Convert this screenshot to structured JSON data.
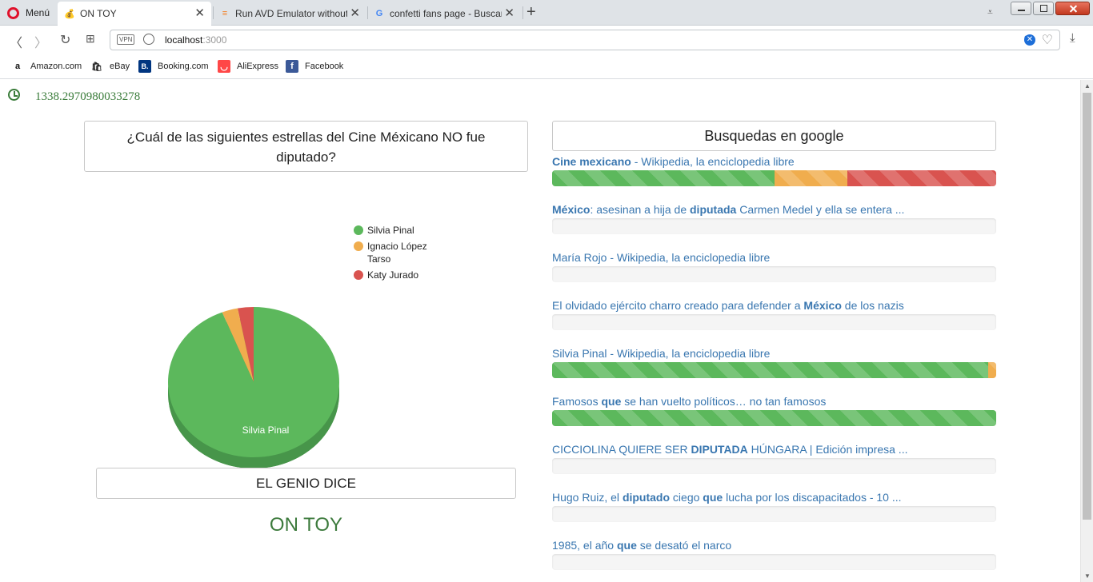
{
  "browser": {
    "menu_label": "Menú",
    "tabs": [
      {
        "title": "ON TOY",
        "icon": "money-bag-icon"
      },
      {
        "title": "Run AVD Emulator without A",
        "icon": "stackoverflow-icon"
      },
      {
        "title": "confetti fans page - Buscar c",
        "icon": "google-icon"
      }
    ],
    "url_host": "localhost",
    "url_port": ":3000",
    "vpn_label": "VPN",
    "adblock_count": "0",
    "bookmarks": [
      {
        "label": "Amazon.com",
        "icon": "amazon-icon",
        "glyph": "a",
        "color": "#111111"
      },
      {
        "label": "eBay",
        "icon": "ebay-icon",
        "glyph": "🛍",
        "color": "#e53238"
      },
      {
        "label": "Booking.com",
        "icon": "booking-icon",
        "glyph": "B.",
        "color": "#003580"
      },
      {
        "label": "AliExpress",
        "icon": "aliexpress-icon",
        "glyph": "◡",
        "color": "#ff4747"
      },
      {
        "label": "Facebook",
        "icon": "facebook-icon",
        "glyph": "f",
        "color": "#3b5998"
      }
    ]
  },
  "page": {
    "timer_value": "1338.2970980033278",
    "question": "¿Cuál de las siguientes estrellas del Cine Méxicano NO fue diputado?",
    "genio_title": "EL GENIO DICE",
    "answer": "ON TOY",
    "search_header": "Busquedas en google"
  },
  "colors": {
    "green": "#5cb85c",
    "orange": "#f0ad4e",
    "red": "#d9534f",
    "link": "#3a77b0",
    "answer": "#3c7a3c"
  },
  "chart_data": {
    "type": "pie",
    "categories": [
      "Silvia Pinal",
      "Ignacio López Tarso",
      "Katy Jurado"
    ],
    "values": [
      94,
      3,
      3
    ],
    "slice_label": "Silvia Pinal",
    "legend_position": "right",
    "colors": [
      "#5cb85c",
      "#f0ad4e",
      "#d9534f"
    ]
  },
  "results": [
    {
      "parts": [
        {
          "t": "Cine mexicano",
          "b": true
        },
        {
          "t": " - Wikipedia, la enciclopedia libre",
          "b": false
        }
      ],
      "bar": [
        {
          "pct": 50,
          "color": "green"
        },
        {
          "pct": 16.5,
          "color": "orange"
        },
        {
          "pct": 33.5,
          "color": "red"
        }
      ]
    },
    {
      "parts": [
        {
          "t": "México",
          "b": true
        },
        {
          "t": ": asesinan a hija de ",
          "b": false
        },
        {
          "t": "diputada",
          "b": true
        },
        {
          "t": " Carmen Medel y ella se entera ...",
          "b": false
        }
      ],
      "bar": []
    },
    {
      "parts": [
        {
          "t": "María Rojo - Wikipedia, la enciclopedia libre",
          "b": false
        }
      ],
      "bar": []
    },
    {
      "parts": [
        {
          "t": "El olvidado ejército charro creado para defender a ",
          "b": false
        },
        {
          "t": "México",
          "b": true
        },
        {
          "t": " de los nazis",
          "b": false
        }
      ],
      "bar": []
    },
    {
      "parts": [
        {
          "t": "Silvia Pinal - Wikipedia, la enciclopedia libre",
          "b": false
        }
      ],
      "bar": [
        {
          "pct": 98.2,
          "color": "green"
        },
        {
          "pct": 1.8,
          "color": "orange"
        }
      ]
    },
    {
      "parts": [
        {
          "t": "Famosos ",
          "b": false
        },
        {
          "t": "que",
          "b": true
        },
        {
          "t": " se han vuelto políticos… no tan famosos",
          "b": false
        }
      ],
      "bar": [
        {
          "pct": 100,
          "color": "green"
        }
      ]
    },
    {
      "parts": [
        {
          "t": "CICCIOLINA QUIERE SER ",
          "b": false
        },
        {
          "t": "DIPUTADA",
          "b": true
        },
        {
          "t": " HÚNGARA | Edición impresa ...",
          "b": false
        }
      ],
      "bar": []
    },
    {
      "parts": [
        {
          "t": "Hugo Ruiz, el ",
          "b": false
        },
        {
          "t": "diputado",
          "b": true
        },
        {
          "t": " ciego ",
          "b": false
        },
        {
          "t": "que",
          "b": true
        },
        {
          "t": " lucha por los discapacitados - 10 ...",
          "b": false
        }
      ],
      "bar": []
    },
    {
      "parts": [
        {
          "t": "1985, el año ",
          "b": false
        },
        {
          "t": "que",
          "b": true
        },
        {
          "t": " se desató el narco",
          "b": false
        }
      ],
      "bar": []
    }
  ]
}
